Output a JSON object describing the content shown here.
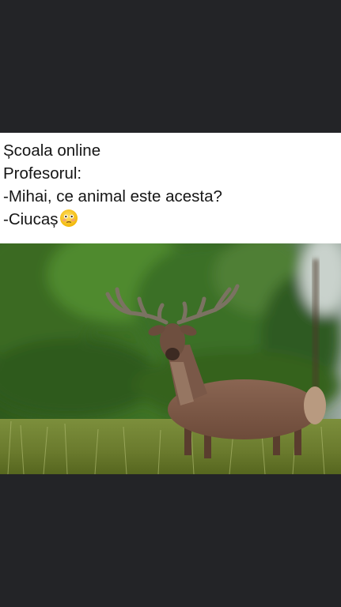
{
  "caption": {
    "line1": "Școala online",
    "line2": "Profesorul:",
    "line3": "-Mihai, ce animal este acesta?",
    "line4": "-Ciucaș"
  },
  "icons": {
    "emoji": "flushed-face-emoji-icon"
  },
  "colors": {
    "background": "#232427",
    "card": "#ffffff",
    "text": "#151515"
  }
}
